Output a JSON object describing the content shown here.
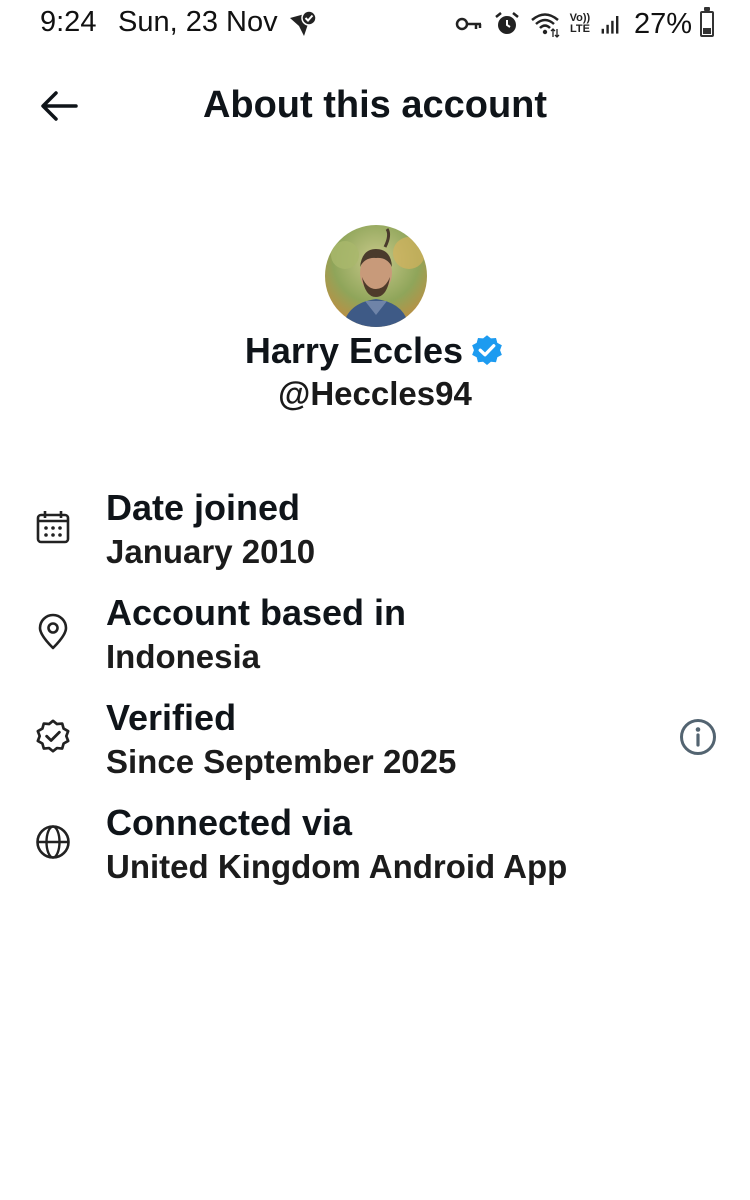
{
  "status_bar": {
    "time": "9:24",
    "date": "Sun, 23 Nov",
    "network_label_top": "Vo))",
    "network_label_bottom": "LTE",
    "battery_percent": "27%",
    "battery_level": 0.27,
    "icons": [
      "messenger-icon",
      "vpn-key-icon",
      "alarm-icon",
      "wifi-icon",
      "signal-icon",
      "battery-icon"
    ]
  },
  "header": {
    "title": "About this account",
    "back_icon": "arrow-left-icon"
  },
  "profile": {
    "display_name": "Harry Eccles",
    "handle": "@Heccles94",
    "verified": true,
    "accent_color": "#1d9bf0"
  },
  "info_items": [
    {
      "icon": "calendar-icon",
      "label": "Date joined",
      "value": "January 2010"
    },
    {
      "icon": "location-pin-icon",
      "label": "Account based in",
      "value": "Indonesia"
    },
    {
      "icon": "verified-badge-icon",
      "label": "Verified",
      "value": "Since September 2025",
      "has_info_button": true
    },
    {
      "icon": "globe-icon",
      "label": "Connected via",
      "value": "United Kingdom Android App"
    }
  ]
}
